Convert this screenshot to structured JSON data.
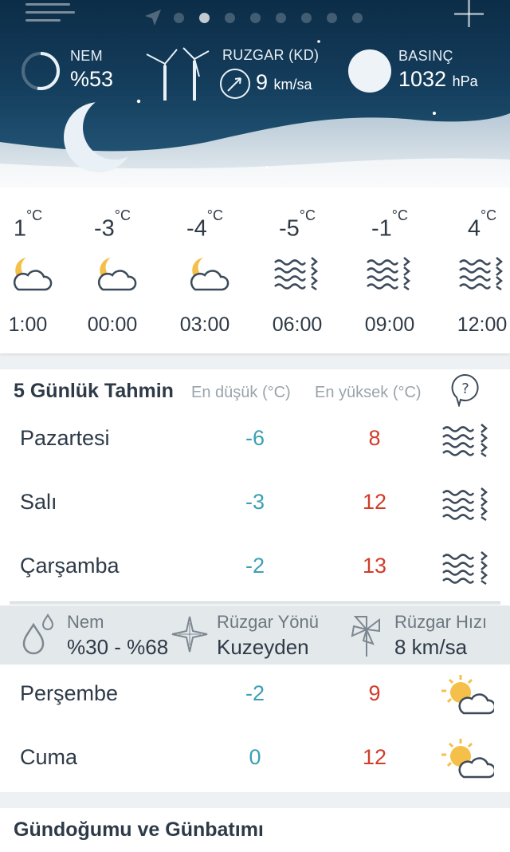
{
  "header": {
    "humidity": {
      "label": "NEM",
      "value": "%53"
    },
    "wind": {
      "label": "RUZGAR (KD)",
      "value": "9",
      "unit": "km/sa"
    },
    "pressure": {
      "label": "BASINÇ",
      "value": "1032",
      "unit": "hPa"
    },
    "page_dots": {
      "count": 8,
      "active_index": 1
    }
  },
  "hourly": [
    {
      "temp": "1",
      "unit": "°C",
      "time": "1:00",
      "icon": "moon-cloud-icon"
    },
    {
      "temp": "-3",
      "unit": "°C",
      "time": "00:00",
      "icon": "moon-cloud-icon"
    },
    {
      "temp": "-4",
      "unit": "°C",
      "time": "03:00",
      "icon": "moon-cloud-icon"
    },
    {
      "temp": "-5",
      "unit": "°C",
      "time": "06:00",
      "icon": "fog-icon"
    },
    {
      "temp": "-1",
      "unit": "°C",
      "time": "09:00",
      "icon": "fog-icon"
    },
    {
      "temp": "4",
      "unit": "°C",
      "time": "12:00",
      "icon": "fog-icon"
    }
  ],
  "forecast": {
    "title": "5 Günlük Tahmin",
    "low_header": "En düşük (°C)",
    "high_header": "En yüksek (°C)",
    "days": [
      {
        "day": "Pazartesi",
        "low": "-6",
        "high": "8",
        "icon": "fog-icon"
      },
      {
        "day": "Salı",
        "low": "-3",
        "high": "12",
        "icon": "fog-icon"
      },
      {
        "day": "Çarşamba",
        "low": "-2",
        "high": "13",
        "icon": "fog-icon"
      },
      {
        "day": "Perşembe",
        "low": "-2",
        "high": "9",
        "icon": "sun-cloud-icon"
      },
      {
        "day": "Cuma",
        "low": "0",
        "high": "12",
        "icon": "sun-cloud-icon"
      }
    ],
    "detail": {
      "humidity_label": "Nem",
      "humidity_value": "%30 - %68",
      "wind_dir_label": "Rüzgar Yönü",
      "wind_dir_value": "Kuzeyden",
      "wind_speed_label": "Rüzgar Hızı",
      "wind_speed_value": "8 km/sa"
    }
  },
  "sun_section": {
    "title": "Gündoğumu ve Günbatımı"
  },
  "colors": {
    "low": "#3aa0b5",
    "high": "#d23c2a",
    "header_dark": "#0c2d47"
  }
}
